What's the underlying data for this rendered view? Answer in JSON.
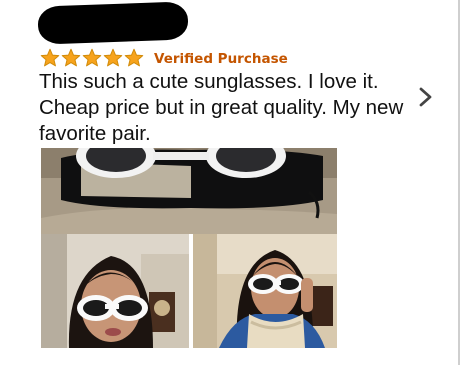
{
  "review": {
    "rating": 5,
    "max_rating": 5,
    "star_color": "#f7a31c",
    "badge": "Verified Purchase",
    "badge_color": "#c45500",
    "body": "This such a cute sunglasses. I love it. Cheap price but in great quality. My new favorite pair.",
    "reviewer_name_redacted": true,
    "photos": [
      {
        "subject": "white sunglasses on black pouch"
      },
      {
        "subject": "reviewer wearing white sunglasses"
      },
      {
        "subject": "reviewer wearing white sunglasses with scarf"
      }
    ]
  },
  "icons": {
    "next": "chevron-right-icon",
    "star": "star-icon"
  }
}
